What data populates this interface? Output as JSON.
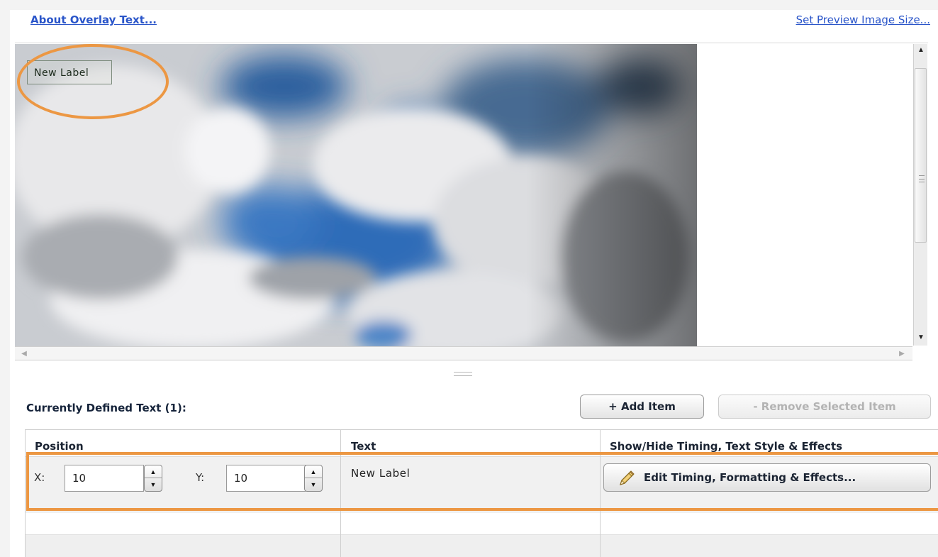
{
  "links": {
    "about": "About Overlay Text...",
    "preview_size": "Set Preview Image Size..."
  },
  "preview": {
    "overlay_label": "New Label"
  },
  "toolbar": {
    "defined_text": "Currently Defined Text (1):",
    "add_item": "+ Add Item",
    "remove_item": "- Remove Selected Item"
  },
  "table": {
    "columns": [
      "Position",
      "Text",
      "Show/Hide Timing, Text Style & Effects"
    ],
    "rows": [
      {
        "x_label": "X:",
        "x_value": "10",
        "y_label": "Y:",
        "y_value": "10",
        "text": "New Label",
        "edit_button": "Edit Timing, Formatting & Effects..."
      }
    ]
  },
  "icons": {
    "scroll_up": "triangle-up-icon",
    "scroll_down": "triangle-down-icon",
    "scroll_left": "triangle-left-icon",
    "scroll_right": "triangle-right-icon",
    "edit": "pencil-icon"
  },
  "colors": {
    "link": "#2a55c9",
    "annotation": "#ec9743",
    "sky": "#3f74b5"
  }
}
